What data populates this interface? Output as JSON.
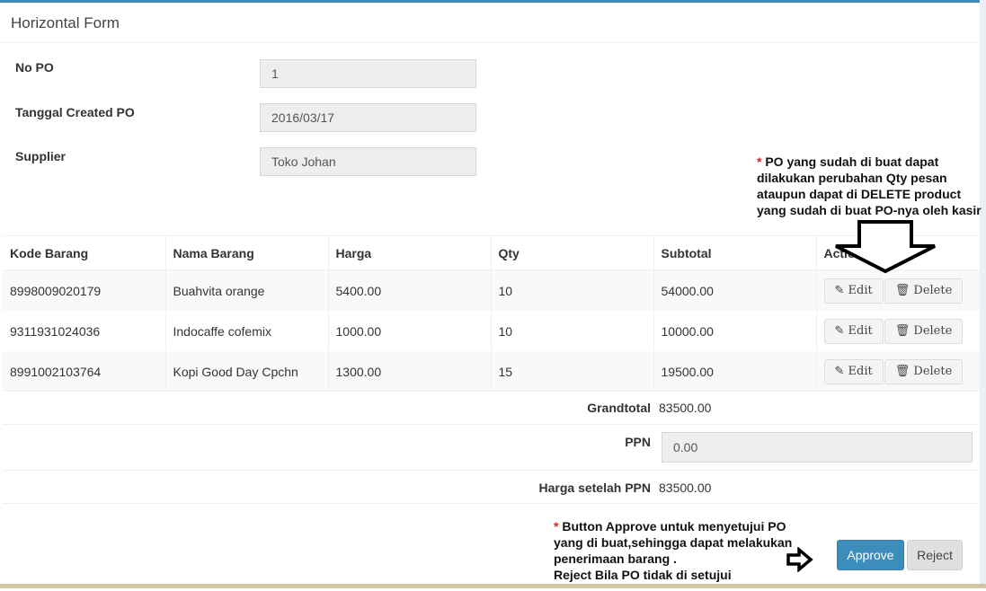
{
  "box": {
    "title": "Horizontal Form"
  },
  "form": {
    "no_po_label": "No PO",
    "no_po_value": "1",
    "tanggal_label": "Tanggal Created PO",
    "tanggal_value": "2016/03/17",
    "supplier_label": "Supplier",
    "supplier_value": "Toko Johan"
  },
  "note_edit": {
    "star": "*",
    "text": " PO yang sudah di buat dapat dilakukan perubahan Qty pesan ataupun dapat di DELETE product yang sudah di buat PO-nya oleh kasir"
  },
  "table": {
    "headers": [
      "Kode Barang",
      "Nama Barang",
      "Harga",
      "Qty",
      "Subtotal",
      "Action"
    ],
    "rows": [
      {
        "kode": "8998009020179",
        "nama": "Buahvita orange",
        "harga": "5400.00",
        "qty": "10",
        "subtotal": "54000.00"
      },
      {
        "kode": "9311931024036",
        "nama": "Indocaffe cofemix",
        "harga": "1000.00",
        "qty": "10",
        "subtotal": "10000.00"
      },
      {
        "kode": "8991002103764",
        "nama": "Kopi Good Day Cpchn",
        "harga": "1300.00",
        "qty": "15",
        "subtotal": "19500.00"
      }
    ],
    "edit_label": "Edit",
    "delete_label": "Delete"
  },
  "summary": {
    "grandtotal_label": "Grandtotal",
    "grandtotal_value": "83500.00",
    "ppn_label": "PPN",
    "ppn_value": "0.00",
    "setelah_label": "Harga setelah PPN",
    "setelah_value": "83500.00"
  },
  "note_approve": {
    "star": "*",
    "line1": " Button Approve untuk menyetujui PO",
    "line2": "yang di buat,sehingga dapat melakukan",
    "line3": "penerimaan barang .",
    "line4": "Reject Bila PO tidak di setujui"
  },
  "buttons": {
    "approve": "Approve",
    "reject": "Reject"
  },
  "icons": {
    "edit": "edit-icon",
    "delete": "trash-icon",
    "arrow_down": "arrow-down-icon",
    "arrow_right": "arrow-right-icon"
  },
  "colors": {
    "primary": "#3c8dbc",
    "note_star": "#dd2222"
  }
}
